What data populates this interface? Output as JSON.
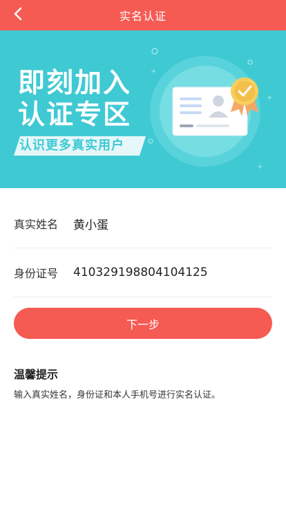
{
  "header": {
    "title": "实名认证",
    "back_icon": "chevron-left-icon",
    "background": "#f55b53"
  },
  "banner": {
    "line1": "即刻加入",
    "line2": "认证专区",
    "subtitle": "认识更多真实用户",
    "background": "#3fc9d3",
    "illustration_icon": "id-card-verified-icon"
  },
  "form": {
    "name_label": "真实姓名",
    "name_value": "黄小蛋",
    "id_label": "身份证号",
    "id_value": "410329198804104125"
  },
  "actions": {
    "next_label": "下一步",
    "accent": "#f55b53"
  },
  "tips": {
    "title": "温馨提示",
    "text": "输入真实姓名，身份证和本人手机号进行实名认证。"
  }
}
